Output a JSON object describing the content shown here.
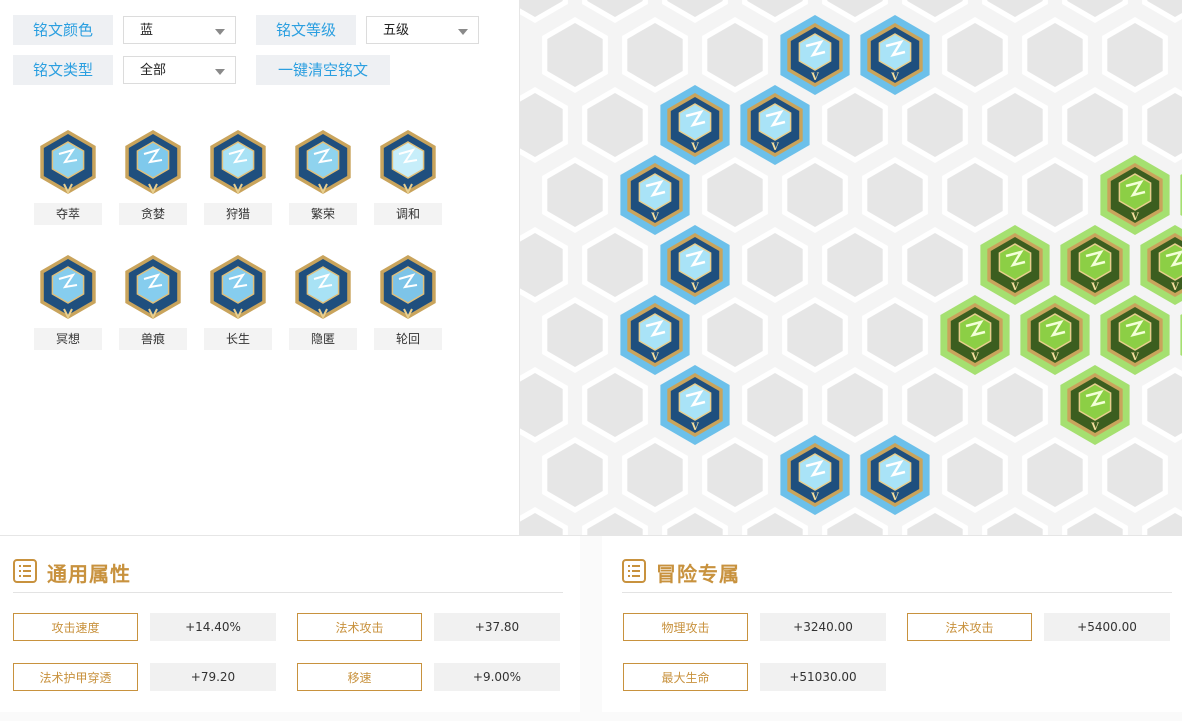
{
  "filters": {
    "color_label": "铭文颜色",
    "color_value": "蓝",
    "level_label": "铭文等级",
    "level_value": "五级",
    "type_label": "铭文类型",
    "type_value": "全部",
    "clear_label": "一键清空铭文"
  },
  "runes": [
    {
      "name": "夺萃",
      "icon": "knot-rune-icon"
    },
    {
      "name": "贪婪",
      "icon": "triangle-ring-rune-icon"
    },
    {
      "name": "狩猎",
      "icon": "lightning-rune-icon"
    },
    {
      "name": "繁荣",
      "icon": "branch-rune-icon"
    },
    {
      "name": "调和",
      "icon": "drop-rune-icon"
    },
    {
      "name": "冥想",
      "icon": "spark-rune-icon"
    },
    {
      "name": "兽痕",
      "icon": "spark-rune-icon"
    },
    {
      "name": "长生",
      "icon": "spark-rune-icon"
    },
    {
      "name": "隐匿",
      "icon": "lightning-rune-icon"
    },
    {
      "name": "轮回",
      "icon": "star-rune-icon"
    }
  ],
  "board": {
    "level_numeral": "V",
    "colors": {
      "blue": "#6cc0ea",
      "green": "#a5e070",
      "red": "#f3b2a8",
      "empty": "#e6e6e6",
      "rim": "#c9a45c"
    }
  },
  "general": {
    "title": "通用属性",
    "stats": [
      {
        "name": "攻击速度",
        "value": "+14.40%"
      },
      {
        "name": "法术攻击",
        "value": "+37.80"
      },
      {
        "name": "法术护甲穿透",
        "value": "+79.20"
      },
      {
        "name": "移速",
        "value": "+9.00%"
      }
    ]
  },
  "adventure": {
    "title": "冒险专属",
    "stats": [
      {
        "name": "物理攻击",
        "value": "+3240.00"
      },
      {
        "name": "法术攻击",
        "value": "+5400.00"
      },
      {
        "name": "最大生命",
        "value": "+51030.00"
      }
    ]
  }
}
